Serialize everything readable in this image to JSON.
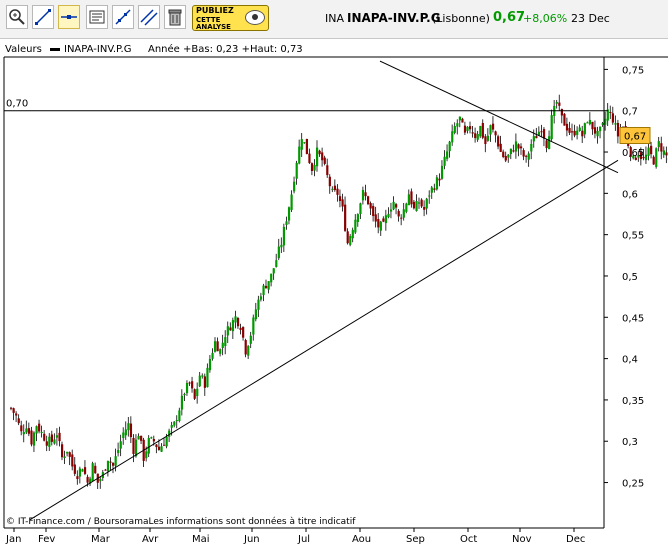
{
  "toolbar": {
    "buttons": [
      {
        "icon": "zoom-in-icon"
      },
      {
        "icon": "draw-line-icon"
      },
      {
        "icon": "horizontal-line-icon"
      },
      {
        "icon": "text-tool-icon"
      },
      {
        "icon": "trend-line-icon"
      },
      {
        "icon": "parallel-line-icon"
      },
      {
        "icon": "trash-icon"
      }
    ],
    "ad": {
      "line1": "PUBLIEZ",
      "line2": "CETTE",
      "line3": "ANALYSE"
    }
  },
  "ticker": {
    "code": "INA",
    "name": "INAPA-INV.P.G",
    "market": "(Lisbonne)",
    "price": "0,67",
    "change": "+8,06%",
    "date": "23 Dec"
  },
  "legend": {
    "valeurs": "Valeurs",
    "series": "INAPA-INV.P.G",
    "range": "Année +Bas: 0,23 +Haut: 0,73"
  },
  "colors": {
    "up": "#009900",
    "down": "#880000",
    "last_price_bg": "#ffc43a",
    "price_text": "#009900"
  },
  "chart_data": {
    "type": "candlestick",
    "title": "INAPA-INV.P.G",
    "ylim": [
      0.2,
      0.76
    ],
    "yticks": [
      "0,25",
      "0,3",
      "0,35",
      "0,4",
      "0,45",
      "0,5",
      "0,55",
      "0,6",
      "0,65",
      "0,7",
      "0,75"
    ],
    "ytick_values": [
      0.25,
      0.3,
      0.35,
      0.4,
      0.45,
      0.5,
      0.55,
      0.6,
      0.65,
      0.7,
      0.75
    ],
    "xticks": [
      "Jan",
      "Fev",
      "Mar",
      "Avr",
      "Mai",
      "Jun",
      "Jul",
      "Aou",
      "Sep",
      "Oct",
      "Nov",
      "Dec"
    ],
    "grid": false,
    "horizontal_line": {
      "value": 0.7,
      "label": "0,70"
    },
    "last_price_label": "0,67",
    "trend_lines": [
      {
        "from": [
          "Jan",
          0.2
        ],
        "to": [
          "Dec",
          0.64
        ]
      },
      {
        "from": [
          "Aou",
          0.76
        ],
        "to": [
          "Dec",
          0.625
        ]
      }
    ],
    "close_path": [
      [
        0,
        0.34
      ],
      [
        4,
        0.33
      ],
      [
        8,
        0.31
      ],
      [
        12,
        0.32
      ],
      [
        16,
        0.3
      ],
      [
        20,
        0.32
      ],
      [
        24,
        0.31
      ],
      [
        28,
        0.3
      ],
      [
        32,
        0.3
      ],
      [
        36,
        0.31
      ],
      [
        40,
        0.28
      ],
      [
        44,
        0.29
      ],
      [
        48,
        0.27
      ],
      [
        52,
        0.26
      ],
      [
        56,
        0.27
      ],
      [
        60,
        0.25
      ],
      [
        64,
        0.27
      ],
      [
        68,
        0.25
      ],
      [
        72,
        0.26
      ],
      [
        76,
        0.28
      ],
      [
        80,
        0.27
      ],
      [
        84,
        0.29
      ],
      [
        88,
        0.31
      ],
      [
        92,
        0.32
      ],
      [
        96,
        0.29
      ],
      [
        100,
        0.31
      ],
      [
        104,
        0.28
      ],
      [
        108,
        0.3
      ],
      [
        112,
        0.3
      ],
      [
        116,
        0.29
      ],
      [
        120,
        0.3
      ],
      [
        124,
        0.31
      ],
      [
        128,
        0.32
      ],
      [
        132,
        0.34
      ],
      [
        136,
        0.36
      ],
      [
        140,
        0.37
      ],
      [
        144,
        0.35
      ],
      [
        148,
        0.38
      ],
      [
        152,
        0.37
      ],
      [
        156,
        0.4
      ],
      [
        160,
        0.42
      ],
      [
        164,
        0.41
      ],
      [
        168,
        0.43
      ],
      [
        172,
        0.44
      ],
      [
        176,
        0.45
      ],
      [
        180,
        0.44
      ],
      [
        184,
        0.41
      ],
      [
        188,
        0.43
      ],
      [
        192,
        0.46
      ],
      [
        196,
        0.48
      ],
      [
        200,
        0.49
      ],
      [
        204,
        0.5
      ],
      [
        208,
        0.52
      ],
      [
        212,
        0.54
      ],
      [
        216,
        0.57
      ],
      [
        220,
        0.6
      ],
      [
        224,
        0.64
      ],
      [
        228,
        0.67
      ],
      [
        232,
        0.65
      ],
      [
        236,
        0.63
      ],
      [
        240,
        0.65
      ],
      [
        244,
        0.64
      ],
      [
        248,
        0.62
      ],
      [
        252,
        0.6
      ],
      [
        256,
        0.6
      ],
      [
        260,
        0.58
      ],
      [
        264,
        0.54
      ],
      [
        268,
        0.56
      ],
      [
        272,
        0.58
      ],
      [
        276,
        0.6
      ],
      [
        280,
        0.59
      ],
      [
        284,
        0.57
      ],
      [
        288,
        0.56
      ],
      [
        292,
        0.56
      ],
      [
        296,
        0.58
      ],
      [
        300,
        0.59
      ],
      [
        304,
        0.57
      ],
      [
        308,
        0.58
      ],
      [
        312,
        0.6
      ],
      [
        316,
        0.58
      ],
      [
        320,
        0.59
      ],
      [
        324,
        0.58
      ],
      [
        328,
        0.6
      ],
      [
        332,
        0.61
      ],
      [
        336,
        0.62
      ],
      [
        340,
        0.64
      ],
      [
        344,
        0.66
      ],
      [
        348,
        0.68
      ],
      [
        352,
        0.69
      ],
      [
        356,
        0.67
      ],
      [
        360,
        0.68
      ],
      [
        364,
        0.67
      ],
      [
        368,
        0.68
      ],
      [
        372,
        0.66
      ],
      [
        376,
        0.68
      ],
      [
        380,
        0.67
      ],
      [
        384,
        0.65
      ],
      [
        388,
        0.64
      ],
      [
        392,
        0.65
      ],
      [
        396,
        0.66
      ],
      [
        400,
        0.65
      ],
      [
        404,
        0.64
      ],
      [
        408,
        0.66
      ],
      [
        412,
        0.67
      ],
      [
        416,
        0.68
      ],
      [
        420,
        0.66
      ],
      [
        424,
        0.69
      ],
      [
        428,
        0.71
      ],
      [
        432,
        0.69
      ],
      [
        436,
        0.68
      ],
      [
        440,
        0.67
      ],
      [
        444,
        0.68
      ],
      [
        448,
        0.67
      ],
      [
        452,
        0.69
      ],
      [
        456,
        0.68
      ],
      [
        460,
        0.67
      ],
      [
        464,
        0.68
      ],
      [
        468,
        0.7
      ],
      [
        472,
        0.69
      ],
      [
        476,
        0.67
      ],
      [
        480,
        0.68
      ],
      [
        484,
        0.66
      ],
      [
        488,
        0.64
      ],
      [
        492,
        0.65
      ],
      [
        496,
        0.64
      ],
      [
        500,
        0.65
      ],
      [
        504,
        0.64
      ],
      [
        508,
        0.66
      ],
      [
        512,
        0.65
      ],
      [
        516,
        0.64
      ],
      [
        520,
        0.65
      ],
      [
        524,
        0.64
      ],
      [
        528,
        0.65
      ],
      [
        532,
        0.64
      ],
      [
        536,
        0.63
      ],
      [
        540,
        0.64
      ],
      [
        544,
        0.62
      ],
      [
        548,
        0.64
      ],
      [
        552,
        0.63
      ],
      [
        556,
        0.64
      ],
      [
        560,
        0.62
      ],
      [
        564,
        0.63
      ],
      [
        568,
        0.64
      ],
      [
        572,
        0.63
      ],
      [
        576,
        0.64
      ],
      [
        580,
        0.62
      ],
      [
        584,
        0.63
      ],
      [
        588,
        0.67
      ]
    ]
  },
  "credit": "© IT-Finance.com / BoursoramaLes informations sont données à titre indicatif"
}
